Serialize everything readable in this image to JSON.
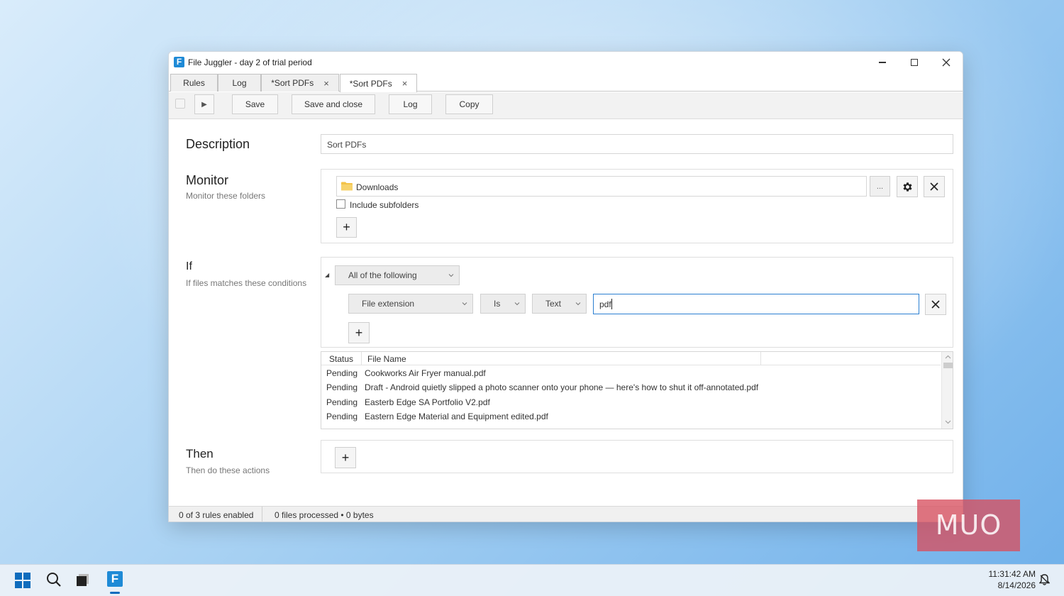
{
  "window": {
    "title": "File Juggler - day 2 of trial period",
    "app_icon_letter": "F"
  },
  "tabs": [
    {
      "label": "Rules",
      "closable": false,
      "active": false
    },
    {
      "label": "Log",
      "closable": false,
      "active": false
    },
    {
      "label": "*Sort PDFs",
      "closable": true,
      "active": false
    },
    {
      "label": "*Sort PDFs",
      "closable": true,
      "active": true
    }
  ],
  "tab_close_glyph": "×",
  "toolbar": {
    "run_glyph": "▶",
    "save_label": "Save",
    "save_close_label": "Save and close",
    "log_label": "Log",
    "copy_label": "Copy"
  },
  "description": {
    "title": "Description",
    "value": "Sort PDFs"
  },
  "monitor": {
    "title": "Monitor",
    "subtitle": "Monitor these folders",
    "folder": "Downloads",
    "browse_label": "...",
    "include_subfolders_label": "Include subfolders",
    "include_subfolders_checked": false,
    "add_glyph": "+"
  },
  "if_section": {
    "title": "If",
    "subtitle": "If files matches these conditions",
    "collapse_glyph": "◢",
    "group_mode": "All of the following",
    "condition": {
      "field": "File extension",
      "operator": "Is",
      "type": "Text",
      "value": "pdf"
    },
    "remove_glyph": "✕",
    "add_glyph": "+"
  },
  "file_list": {
    "columns": [
      "Status",
      "File Name"
    ],
    "rows": [
      {
        "status": "Pending",
        "name": "Cookworks Air Fryer manual.pdf"
      },
      {
        "status": "Pending",
        "name": "Draft - Android quietly slipped a photo scanner onto your phone — here's how to shut it off-annotated.pdf"
      },
      {
        "status": "Pending",
        "name": "Easterb Edge SA Portfolio V2.pdf"
      },
      {
        "status": "Pending",
        "name": "Eastern Edge Material and Equipment edited.pdf"
      }
    ]
  },
  "then_section": {
    "title": "Then",
    "subtitle": "Then do these actions",
    "add_glyph": "+"
  },
  "status_bar": {
    "rules_enabled": "0 of 3 rules enabled",
    "files_processed": "0 files processed • 0 bytes"
  },
  "watermark": "MUO",
  "taskbar": {
    "time": "11:31:42 AM",
    "date": "8/14/2026",
    "pinned_app_letter": "F"
  },
  "colors": {
    "accent": "#1e8ad6",
    "focus_border": "#2b7fd1"
  }
}
